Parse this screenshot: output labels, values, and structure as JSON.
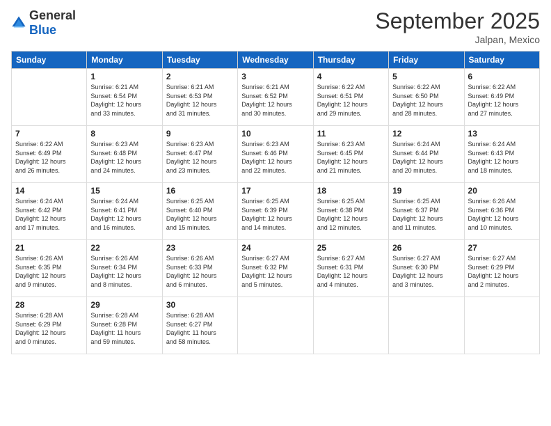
{
  "logo": {
    "general": "General",
    "blue": "Blue"
  },
  "header": {
    "month": "September 2025",
    "location": "Jalpan, Mexico"
  },
  "days": [
    "Sunday",
    "Monday",
    "Tuesday",
    "Wednesday",
    "Thursday",
    "Friday",
    "Saturday"
  ],
  "weeks": [
    [
      {
        "day": "",
        "content": ""
      },
      {
        "day": "1",
        "content": "Sunrise: 6:21 AM\nSunset: 6:54 PM\nDaylight: 12 hours\nand 33 minutes."
      },
      {
        "day": "2",
        "content": "Sunrise: 6:21 AM\nSunset: 6:53 PM\nDaylight: 12 hours\nand 31 minutes."
      },
      {
        "day": "3",
        "content": "Sunrise: 6:21 AM\nSunset: 6:52 PM\nDaylight: 12 hours\nand 30 minutes."
      },
      {
        "day": "4",
        "content": "Sunrise: 6:22 AM\nSunset: 6:51 PM\nDaylight: 12 hours\nand 29 minutes."
      },
      {
        "day": "5",
        "content": "Sunrise: 6:22 AM\nSunset: 6:50 PM\nDaylight: 12 hours\nand 28 minutes."
      },
      {
        "day": "6",
        "content": "Sunrise: 6:22 AM\nSunset: 6:49 PM\nDaylight: 12 hours\nand 27 minutes."
      }
    ],
    [
      {
        "day": "7",
        "content": "Sunrise: 6:22 AM\nSunset: 6:49 PM\nDaylight: 12 hours\nand 26 minutes."
      },
      {
        "day": "8",
        "content": "Sunrise: 6:23 AM\nSunset: 6:48 PM\nDaylight: 12 hours\nand 24 minutes."
      },
      {
        "day": "9",
        "content": "Sunrise: 6:23 AM\nSunset: 6:47 PM\nDaylight: 12 hours\nand 23 minutes."
      },
      {
        "day": "10",
        "content": "Sunrise: 6:23 AM\nSunset: 6:46 PM\nDaylight: 12 hours\nand 22 minutes."
      },
      {
        "day": "11",
        "content": "Sunrise: 6:23 AM\nSunset: 6:45 PM\nDaylight: 12 hours\nand 21 minutes."
      },
      {
        "day": "12",
        "content": "Sunrise: 6:24 AM\nSunset: 6:44 PM\nDaylight: 12 hours\nand 20 minutes."
      },
      {
        "day": "13",
        "content": "Sunrise: 6:24 AM\nSunset: 6:43 PM\nDaylight: 12 hours\nand 18 minutes."
      }
    ],
    [
      {
        "day": "14",
        "content": "Sunrise: 6:24 AM\nSunset: 6:42 PM\nDaylight: 12 hours\nand 17 minutes."
      },
      {
        "day": "15",
        "content": "Sunrise: 6:24 AM\nSunset: 6:41 PM\nDaylight: 12 hours\nand 16 minutes."
      },
      {
        "day": "16",
        "content": "Sunrise: 6:25 AM\nSunset: 6:40 PM\nDaylight: 12 hours\nand 15 minutes."
      },
      {
        "day": "17",
        "content": "Sunrise: 6:25 AM\nSunset: 6:39 PM\nDaylight: 12 hours\nand 14 minutes."
      },
      {
        "day": "18",
        "content": "Sunrise: 6:25 AM\nSunset: 6:38 PM\nDaylight: 12 hours\nand 12 minutes."
      },
      {
        "day": "19",
        "content": "Sunrise: 6:25 AM\nSunset: 6:37 PM\nDaylight: 12 hours\nand 11 minutes."
      },
      {
        "day": "20",
        "content": "Sunrise: 6:26 AM\nSunset: 6:36 PM\nDaylight: 12 hours\nand 10 minutes."
      }
    ],
    [
      {
        "day": "21",
        "content": "Sunrise: 6:26 AM\nSunset: 6:35 PM\nDaylight: 12 hours\nand 9 minutes."
      },
      {
        "day": "22",
        "content": "Sunrise: 6:26 AM\nSunset: 6:34 PM\nDaylight: 12 hours\nand 8 minutes."
      },
      {
        "day": "23",
        "content": "Sunrise: 6:26 AM\nSunset: 6:33 PM\nDaylight: 12 hours\nand 6 minutes."
      },
      {
        "day": "24",
        "content": "Sunrise: 6:27 AM\nSunset: 6:32 PM\nDaylight: 12 hours\nand 5 minutes."
      },
      {
        "day": "25",
        "content": "Sunrise: 6:27 AM\nSunset: 6:31 PM\nDaylight: 12 hours\nand 4 minutes."
      },
      {
        "day": "26",
        "content": "Sunrise: 6:27 AM\nSunset: 6:30 PM\nDaylight: 12 hours\nand 3 minutes."
      },
      {
        "day": "27",
        "content": "Sunrise: 6:27 AM\nSunset: 6:29 PM\nDaylight: 12 hours\nand 2 minutes."
      }
    ],
    [
      {
        "day": "28",
        "content": "Sunrise: 6:28 AM\nSunset: 6:29 PM\nDaylight: 12 hours\nand 0 minutes."
      },
      {
        "day": "29",
        "content": "Sunrise: 6:28 AM\nSunset: 6:28 PM\nDaylight: 11 hours\nand 59 minutes."
      },
      {
        "day": "30",
        "content": "Sunrise: 6:28 AM\nSunset: 6:27 PM\nDaylight: 11 hours\nand 58 minutes."
      },
      {
        "day": "",
        "content": ""
      },
      {
        "day": "",
        "content": ""
      },
      {
        "day": "",
        "content": ""
      },
      {
        "day": "",
        "content": ""
      }
    ]
  ]
}
